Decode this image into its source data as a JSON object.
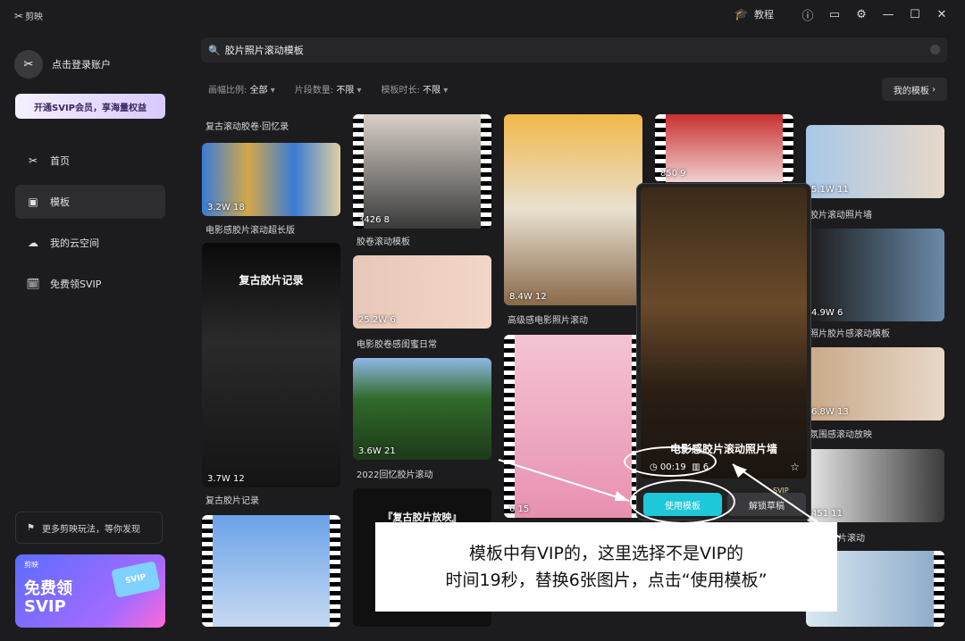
{
  "app": {
    "title": "剪映"
  },
  "titlebar": {
    "tutorial": "教程"
  },
  "sidebar": {
    "account_label": "点击登录账户",
    "svip_button": "开通SVIP会员，享海量权益",
    "items": [
      {
        "label": "首页",
        "icon": "scissors-icon"
      },
      {
        "label": "模板",
        "icon": "template-icon"
      },
      {
        "label": "我的云空间",
        "icon": "cloud-icon"
      },
      {
        "label": "免费领SVIP",
        "icon": "gift-icon"
      }
    ],
    "more_tips": "更多剪映玩法，等你发现",
    "promo": {
      "brand": "剪映",
      "line1": "免费领",
      "line2": "SVIP",
      "card": "SVIP"
    }
  },
  "search": {
    "query": "胶片照片滚动模板"
  },
  "filters": [
    {
      "label": "画幅比例:",
      "value": "全部"
    },
    {
      "label": "片段数量:",
      "value": "不限"
    },
    {
      "label": "模板时长:",
      "value": "不限"
    }
  ],
  "my_templates": "我的模板",
  "cards": [
    {
      "caption": "复古滚动胶卷·回忆录"
    },
    {
      "stats": "3.2W  18",
      "caption": "电影感胶片滚动超长版"
    },
    {
      "title": "复古胶片记录",
      "stats": "3.7W  12",
      "caption": "复古胶片记录"
    },
    {
      "stats": "3426  8",
      "caption": "胶卷滚动模板"
    },
    {
      "stats": "25.2W  6",
      "caption": "电影胶卷感闺蜜日常"
    },
    {
      "stats": "3.6W  21",
      "caption": "2022回忆胶片滚动"
    },
    {
      "title": "『复古胶片放映』"
    },
    {
      "stats": "8.4W  12",
      "caption": "高级感电影照片滚动"
    },
    {
      "stats": "6  15"
    },
    {
      "stats": "850  9"
    },
    {
      "stats": "5.1W  11",
      "caption": "胶片滚动照片墙"
    },
    {
      "stats": "4.9W  6",
      "caption": "照片胶片感滚动模板"
    },
    {
      "stats": "6.8W  13",
      "caption": "氛围感滚动放映"
    },
    {
      "stats": "451  11",
      "caption": "片滚动"
    }
  ],
  "popup": {
    "title": "电影感胶片滚动照片墙",
    "duration": "00:19",
    "count": "6",
    "use_button": "使用模板",
    "draft_button": "解锁草稿",
    "svip": "SVIP"
  },
  "annotation": {
    "line1": "模板中有VIP的，这里选择不是VIP的",
    "line2": "时间19秒，替换6张图片，点击“使用模板”"
  }
}
